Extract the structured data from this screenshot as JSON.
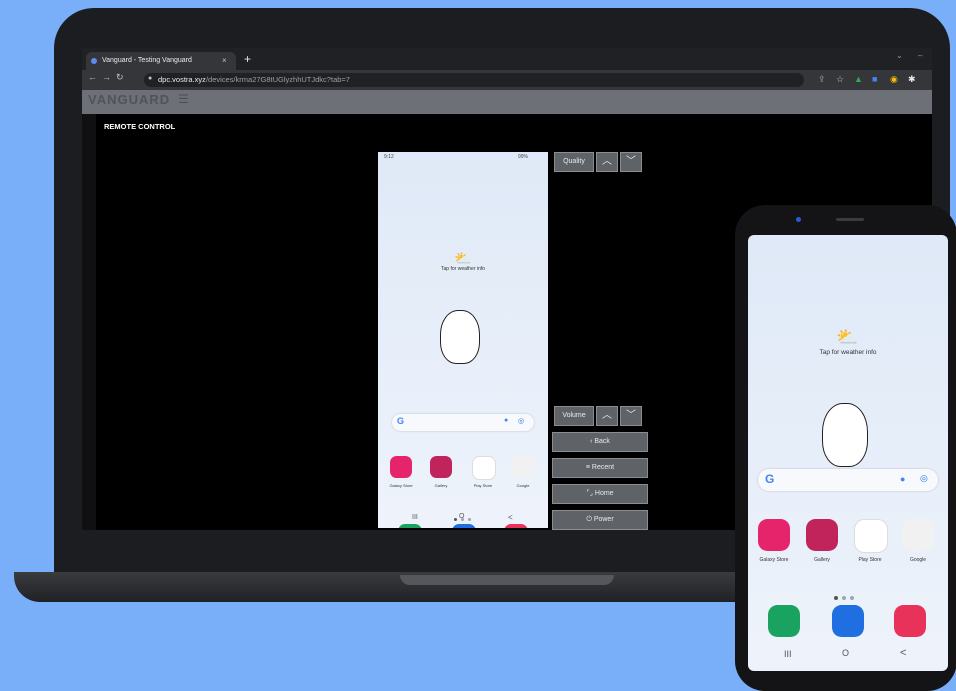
{
  "browser": {
    "tab_title": "Vanguard - Testing Vanguard",
    "tab_close": "×",
    "new_tab": "+",
    "url_host": "dpc.vostra.xyz",
    "url_path": "/devices/krma27G8tUGlyzhhUTJdkc?tab=7"
  },
  "page": {
    "brand": "VANGUARD",
    "title": "REMOTE CONTROL"
  },
  "controls": {
    "quality_label": "Quality",
    "volume_label": "Volume",
    "back_label": "Back",
    "recent_label": "Recent",
    "home_label": "Home",
    "power_label": "Power"
  },
  "phone_home": {
    "status_time": "9:12",
    "status_battery": "99%",
    "weather_text": "Tap for weather info",
    "apps": [
      {
        "label": "Galaxy Store",
        "color": "#e5246b"
      },
      {
        "label": "Gallery",
        "color": "#c0245b"
      },
      {
        "label": "Play Store",
        "color": "#ffffff"
      },
      {
        "label": "Google",
        "color": "#f1f1f1"
      }
    ],
    "dock_colors": [
      "#1aa260",
      "#1f6fe0",
      "#e8325a"
    ],
    "nav_recent": "III",
    "nav_home": "O",
    "nav_back": "<"
  }
}
